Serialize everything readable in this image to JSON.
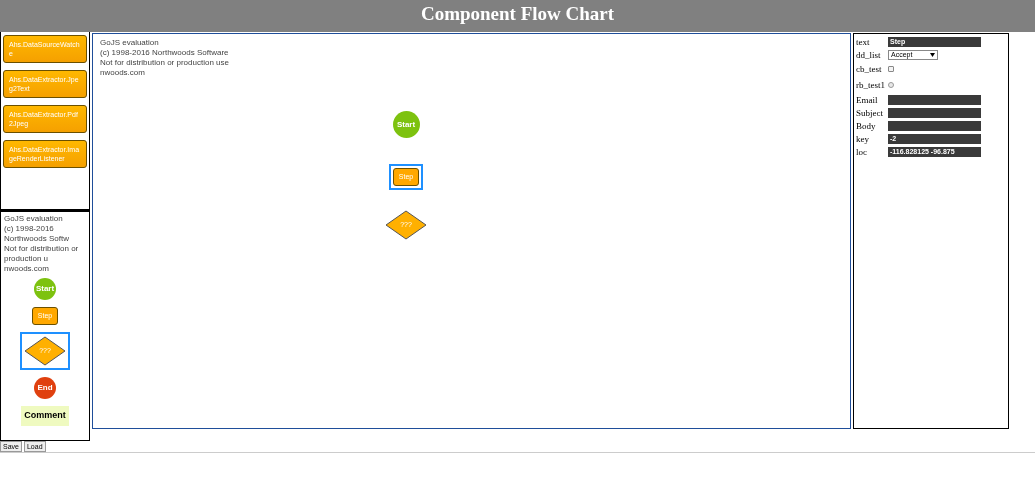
{
  "header": {
    "title": "Component Flow Chart"
  },
  "palette_watermark": [
    "GoJS evaluation",
    "(c) 1998-2016 Northwoods Softw",
    "Not for distribution or production u",
    "nwoods.com"
  ],
  "canvas_watermark": [
    "GoJS evaluation",
    "(c) 1998-2016 Northwoods Software",
    "Not for distribution or production use",
    "nwoods.com"
  ],
  "component_palette": {
    "items": [
      {
        "text": "Ahs.DataSourceWatche"
      },
      {
        "text": "Ahs.DataExtractor.Jpeg2Text"
      },
      {
        "text": "Ahs.DataExtractor.Pdf2Jpeg"
      },
      {
        "text": "Ahs.DataExtractor.ImageRenderListener"
      }
    ]
  },
  "shape_palette": {
    "items": [
      {
        "kind": "start",
        "text": "Start",
        "selected": false
      },
      {
        "kind": "step",
        "text": "Step",
        "selected": false
      },
      {
        "kind": "decision",
        "text": "???",
        "selected": true
      },
      {
        "kind": "end",
        "text": "End",
        "selected": false
      },
      {
        "kind": "comment",
        "text": "Comment",
        "selected": false
      }
    ]
  },
  "diagram": {
    "nodes": [
      {
        "kind": "start",
        "text": "Start",
        "selected": false
      },
      {
        "kind": "step",
        "text": "Step",
        "selected": true
      },
      {
        "kind": "decision",
        "text": "???",
        "selected": false
      }
    ]
  },
  "inspector": {
    "rows": [
      {
        "kind": "text",
        "label": "text",
        "value": "Step"
      },
      {
        "kind": "select",
        "label": "dd_list",
        "value": "Accept"
      },
      {
        "kind": "checkbox",
        "label": "cb_test",
        "checked": false
      },
      {
        "kind": "radio",
        "label": "rb_test1",
        "checked": false
      },
      {
        "kind": "text",
        "label": "Email"
      },
      {
        "kind": "text",
        "label": "Subject"
      },
      {
        "kind": "text",
        "label": "Body"
      },
      {
        "kind": "text",
        "label": "key",
        "value": "-2"
      },
      {
        "kind": "text",
        "label": "loc",
        "value": "-116.828125 -96.875"
      }
    ]
  },
  "buttons": [
    "Save",
    "Load"
  ]
}
